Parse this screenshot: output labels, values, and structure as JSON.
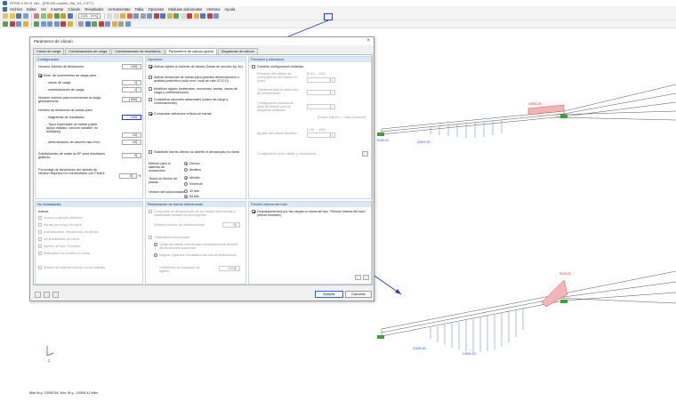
{
  "window": {
    "title": "RFEM 5.25.01 x64 - [IPE400-modelo_fila_1f1_C077]"
  },
  "menu": [
    "Archivo",
    "Editar",
    "Ver",
    "Insertar",
    "Cálculo",
    "Resultados",
    "Herramientas",
    "Tabla",
    "Opciones",
    "Módulos adicionales",
    "Ventana",
    "Ayuda"
  ],
  "toolbar": {
    "load_combo": "CO1 - G+Q",
    "highlighted": "calc-params-icon"
  },
  "dialog": {
    "title": "Parámetros de cálculo",
    "tabs": [
      "Casos de carga",
      "Combinaciones de carga",
      "Combinaciones de resultados",
      "Parámetros de cálculo global",
      "Diagramas de cálculo"
    ],
    "active_tab": 3,
    "config": {
      "head": "Configuración",
      "max_iter_label": "Número máximo de iteraciones:",
      "max_iter": "100",
      "load_incr_label": "Núm. de incrementos de carga para",
      "lc_label": "- casos de carga:",
      "lc": "1",
      "co_label": "- combinaciones de carga:",
      "co": "1",
      "max_incr_label": "Número máximo para incrementar la carga gradualmente:",
      "max_incr": "1000",
      "div_label": "Número de divisiones de barras para",
      "diag_label": "- diagramas de resultados:",
      "diag": "100",
      "special_label": "- Tipos especiales de barras (cable, apoyo elástico, sección variable, no lineal(es)):",
      "special": "10",
      "defl_label": "- determinación de valores máx./mín.:",
      "defl": "10",
      "fe_label": "Subdivisiones de malla de EF para resultados gráficos:",
      "fe": "0",
      "nr_label": "Porcentaje de iteraciones del método de Newton-Raphson en combinación con Picard:",
      "nr": "5",
      "nr_unit": "%"
    },
    "options": {
      "head": "Opciones",
      "o1": "Activar rigidez a cortante de barras (Áreas de sección Ay, Az)",
      "o2": "Activar divisiones de barras para grandes deformaciones o análisis postcrítico (sólo mod. local de cálc.CC/CO)",
      "o3": "Modificar rigidez (materiales, secciones, barras, casos de carga y combinaciones)",
      "o4": "Considerar opciones adicionales (casos de carga y combinaciones)",
      "o5": "Comprobar esfuerzos críticos de barras",
      "o6": "Subdividir barras directo no abierto ni armado(as) no lineal",
      "eq_method_label": "Método para el sistema de ecuaciones:",
      "eq_direct": "Directo",
      "eq_iter": "Iterativo",
      "plate_label": "Teoría de flexión de placas:",
      "plate_m": "Mindlin",
      "plate_k": "Kirchhoff",
      "solver_label": "Versión del solucionador:",
      "solver_32": "32 bits",
      "solver_64": "64 bits"
    },
    "precision": {
      "head": "Precisión y tolerancia",
      "p1": "Cambiar configuración estándar",
      "p2": "Precisión del criterio de convergencia del cálculo no lineal:",
      "p2_range": "[0,01 ... 100]",
      "p3": "Tolerancia para la detección de inestabilidad:",
      "p4": "Configuración robusta de paso de tiempo para la relajación dinámica:",
      "p4_note": "(Factor inferior => Más precisión)",
      "p5": "Ajustes del cálculo iterativo:",
      "p5_range": "[1,00 ... 100]",
      "p6": "Configuración para cables y membranas ..."
    },
    "nonlinear": {
      "head": "No linealidades",
      "activate": "Activar",
      "n1": "Apoyos y apoyos elásticos",
      "n2": "Barras por el tipo de barra",
      "n3": "Articulaciones, liberaciones de barras",
      "n4": "No linealidades de barra",
      "n5": "Ajustes de tipo \"Contacto\"",
      "n6": "Materiales con modelo no lineal",
      "n7": "Modelo de material isótropo termo elástico"
    },
    "deactivation": {
      "head": "Reactivación de barras defectuosas",
      "d1": "Comprobar la desactivación de las barras defectuosas y reactivarlas durante la convergencia",
      "d2": "Número máximo de reactivaciones:",
      "d2_val": "5",
      "d3": "Tratamiento excepcional",
      "d4": "Quitar las barras defectuosas individualmente durante las iteraciones sucesivas",
      "d5": "Asignar rigideces reducidas a las barras defectuosas",
      "d6": "Coeficiente de reducción de rigidez:",
      "d6_val": "1000"
    },
    "internal": {
      "head": "Presión interna del tubo",
      "i1": "Desplazamientos por las cargas en barra del tipo \"Presión interna del tubo\" (efecto Bourdon)"
    },
    "buttons": {
      "ok": "Aceptar",
      "cancel": "Cancelar"
    }
  },
  "model": {
    "top_label_1": "15000,00",
    "top_label_2": "23000,00",
    "top_label_3": "9100,00",
    "bottom_label_1": "21609,40",
    "bottom_label_2": "24500,20",
    "bottom_label_3": "5120,02",
    "axis_z": "Z",
    "axis_x": "X"
  },
  "status_text": "Máx M-y: 23000.54, Mín. M-y: -10006.42 kNm"
}
